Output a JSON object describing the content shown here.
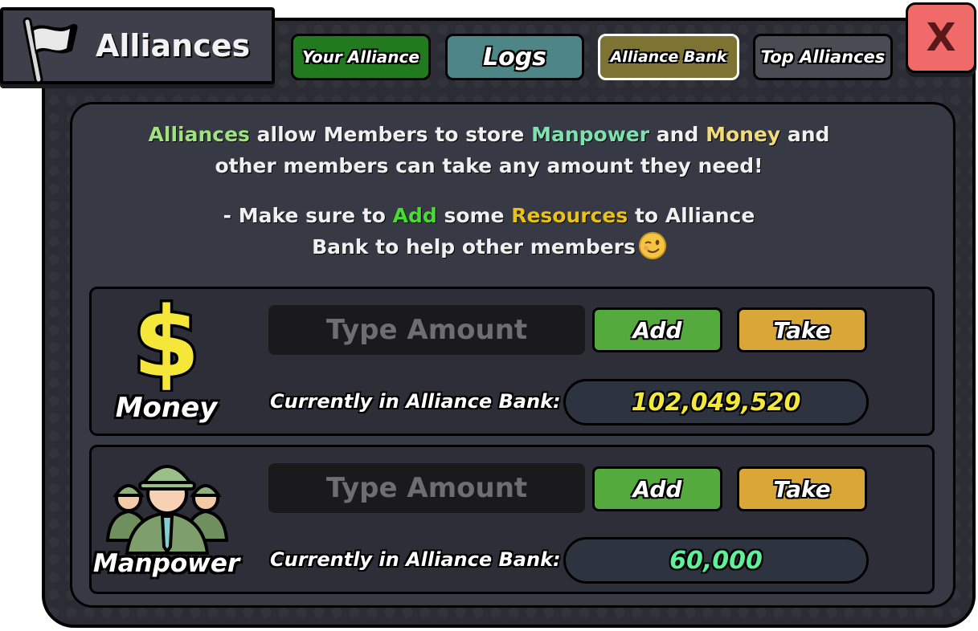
{
  "window": {
    "title": "Alliances",
    "close_label": "X"
  },
  "tabs": [
    {
      "label": "Your Alliance",
      "color": "#227a1f"
    },
    {
      "label": "Logs",
      "color": "#4e8688"
    },
    {
      "label": "Alliance Bank",
      "color": "#7d7433",
      "selected": true
    },
    {
      "label": "Top Alliances",
      "color": "#4a4b53"
    }
  ],
  "description": {
    "p1": {
      "w1": "Alliances",
      "t1": " allow Members to store ",
      "w2": "Manpower",
      "t2": " and ",
      "w3": "Money",
      "t3": " and",
      "line2": "other members can take any amount they need!"
    },
    "p2": {
      "t1": "- Make sure to ",
      "w1": "Add",
      "t2": " some ",
      "w2": "Resources",
      "t3": " to Alliance",
      "line2": "Bank to help other members"
    }
  },
  "resources": [
    {
      "name": "Money",
      "icon": "dollar-icon",
      "input_placeholder": "Type Amount",
      "add_label": "Add",
      "take_label": "Take",
      "bank_label": "Currently in Alliance Bank:",
      "bank_value": "102,049,520",
      "value_color": "#f3e83c"
    },
    {
      "name": "Manpower",
      "icon": "soldiers-icon",
      "input_placeholder": "Type Amount",
      "add_label": "Add",
      "take_label": "Take",
      "bank_label": "Currently in Alliance Bank:",
      "bank_value": "60,000",
      "value_color": "#5ef09a"
    }
  ]
}
